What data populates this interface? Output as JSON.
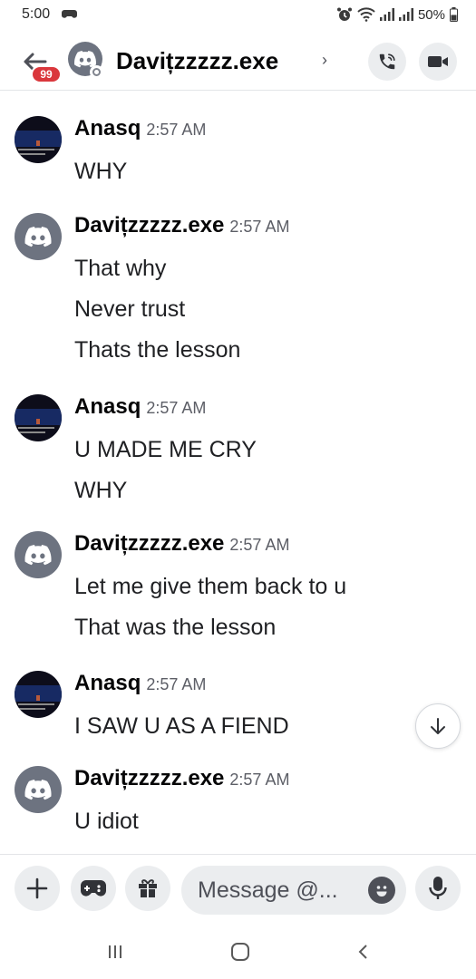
{
  "status_bar": {
    "time": "5:00",
    "battery_text": "50%"
  },
  "header": {
    "title": "Davițzzzzz.exe",
    "badge_count": "99",
    "chevron": "›",
    "icons": [
      "back-arrow-icon",
      "discord-icon",
      "phone-icon",
      "video-camera-icon"
    ]
  },
  "messages": [
    {
      "author": "Anasq",
      "time": "2:57 AM",
      "avatar": "anasq-avatar",
      "lines": [
        "WHY"
      ]
    },
    {
      "author": "Davițzzzzz.exe",
      "time": "2:57 AM",
      "avatar": "discord-default-avatar",
      "lines": [
        "That why",
        "Never trust",
        "Thats the lesson"
      ]
    },
    {
      "author": "Anasq",
      "time": "2:57 AM",
      "avatar": "anasq-avatar",
      "lines": [
        "U MADE ME CRY",
        "WHY"
      ]
    },
    {
      "author": "Davițzzzzz.exe",
      "time": "2:57 AM",
      "avatar": "discord-default-avatar",
      "lines": [
        "Let me give them back to u",
        "That was the lesson"
      ]
    },
    {
      "author": "Anasq",
      "time": "2:57 AM",
      "avatar": "anasq-avatar",
      "lines": [
        "I SAW U AS A FIEND"
      ]
    },
    {
      "author": "Davițzzzzz.exe",
      "time": "2:57 AM",
      "avatar": "discord-default-avatar",
      "lines": [
        "U idiot"
      ]
    }
  ],
  "composer": {
    "placeholder": "Message @...",
    "icons": [
      "plus-icon",
      "gamepad-icon",
      "gift-icon",
      "emoji-icon",
      "microphone-icon"
    ]
  },
  "colors": {
    "badge": "#da373c",
    "avatar_gray": "#6d7380",
    "button_bg": "#ebedef",
    "text_dark": "#060607"
  }
}
